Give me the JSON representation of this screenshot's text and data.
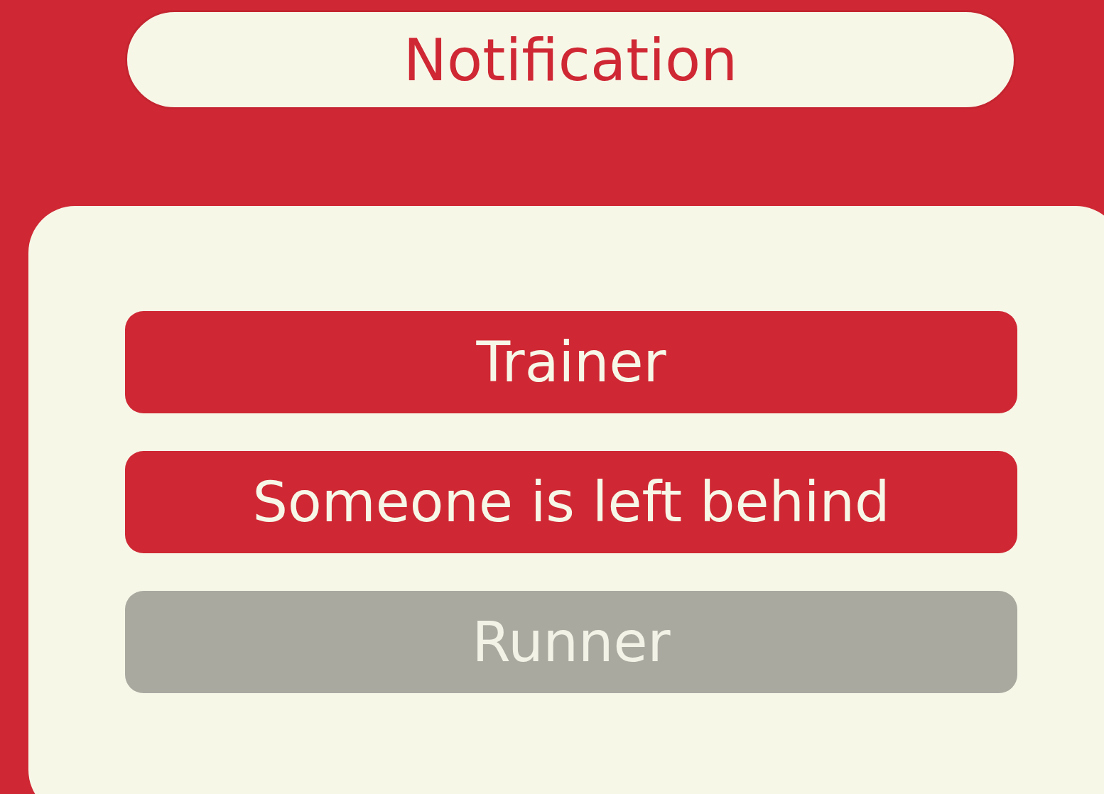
{
  "title": "Notification",
  "options": [
    {
      "label": "Trainer",
      "disabled": false
    },
    {
      "label": "Someone is left behind",
      "disabled": false
    },
    {
      "label": "Runner",
      "disabled": true
    }
  ]
}
